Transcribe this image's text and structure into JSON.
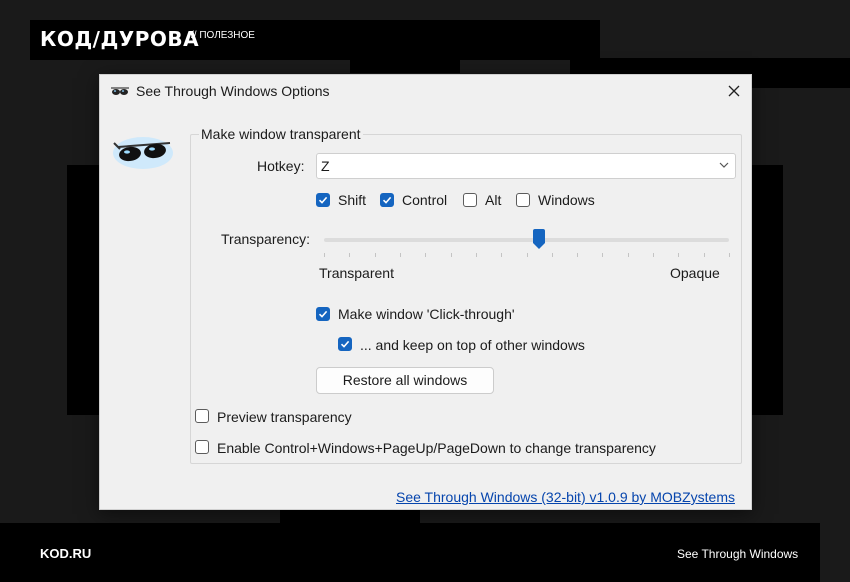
{
  "page": {
    "brand": "КОД/ДУРОВА",
    "brand_tag": "// ПОЛЕЗНОЕ",
    "footer_left": "KOD.RU",
    "footer_right": "See Through Windows"
  },
  "window": {
    "title": "See Through Windows Options",
    "icons": {
      "app": "sunglasses-icon",
      "close": "close-icon"
    }
  },
  "group": {
    "label": "Make window transparent",
    "hotkey_label": "Hotkey:",
    "hotkey_value": "Z",
    "modifiers": [
      {
        "label": "Shift",
        "checked": true
      },
      {
        "label": "Control",
        "checked": true
      },
      {
        "label": "Alt",
        "checked": false
      },
      {
        "label": "Windows",
        "checked": false
      }
    ],
    "transparency_label": "Transparency:",
    "transparency_value": 0.53,
    "min_label": "Transparent",
    "max_label": "Opaque",
    "click_through": {
      "label": "Make window 'Click-through'",
      "checked": true
    },
    "keep_on_top": {
      "label": "... and keep on top of other windows",
      "checked": true
    },
    "restore_button": "Restore all windows",
    "preview": {
      "label": "Preview transparency",
      "checked": false
    },
    "hotkeys_pageupdown": {
      "label": "Enable Control+Windows+PageUp/PageDown to change transparency",
      "checked": false
    }
  },
  "about_link": "See Through Windows (32-bit) v1.0.9 by MOBZystems",
  "colors": {
    "accent": "#1565c0",
    "link": "#0645ad"
  }
}
